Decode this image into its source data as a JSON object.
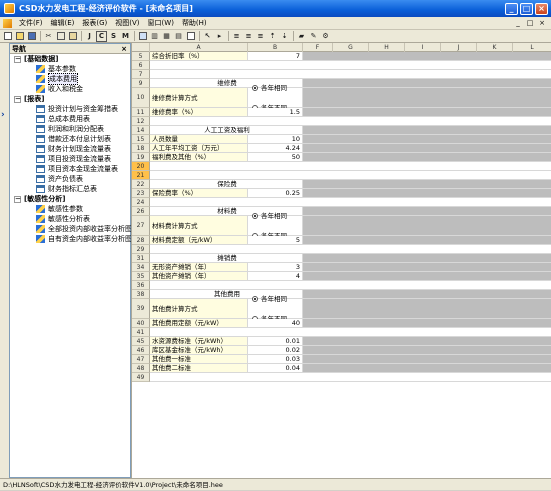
{
  "window": {
    "title": "CSD水力发电工程-经济评价软件 - [未命名项目]",
    "btn_min": "_",
    "btn_max": "□",
    "btn_close": "×"
  },
  "menu": {
    "items": [
      {
        "label": "文件(F)"
      },
      {
        "label": "编辑(E)"
      },
      {
        "label": "报表(G)"
      },
      {
        "label": "视图(V)"
      },
      {
        "label": "窗口(W)"
      },
      {
        "label": "帮助(H)"
      }
    ],
    "mdi": [
      "_",
      "□",
      "×"
    ]
  },
  "toolbar": {
    "letters": [
      "J",
      "C",
      "S",
      "M"
    ]
  },
  "nav": {
    "title": "导航",
    "close": "×",
    "groups": [
      {
        "label": "[基础数据]",
        "toggle": "－",
        "items": [
          "基本参数",
          "成本费用",
          "收入和税金"
        ]
      },
      {
        "label": "[报表]",
        "toggle": "－",
        "items": [
          "投资计划与资金筹措表",
          "总成本费用表",
          "利润和利润分配表",
          "借款还本付息计划表",
          "财务计划现金流量表",
          "项目投资现金流量表",
          "项目资本金现金流量表",
          "资产负债表",
          "财务指标汇总表"
        ]
      },
      {
        "label": "[敏感性分析]",
        "toggle": "－",
        "items": [
          "敏感性参数",
          "敏感性分析表",
          "全部投资内部收益率分析图",
          "自有资金内部收益率分析图"
        ]
      }
    ],
    "selected": "成本费用"
  },
  "sheet": {
    "columns": [
      "A",
      "B",
      "F",
      "G",
      "H",
      "I",
      "J",
      "K",
      "L"
    ],
    "rows": [
      {
        "n": "5",
        "a": "综合折旧率（%）",
        "b": "7"
      },
      {
        "n": "6"
      },
      {
        "n": "7"
      },
      {
        "n": "9",
        "a": "维修费"
      },
      {
        "n": "10",
        "a": "维修费计算方式",
        "radio": [
          "各年相同",
          "各年不同"
        ],
        "checked": 0
      },
      {
        "n": "11",
        "a": "维修费率（%）",
        "b": "1.5"
      },
      {
        "n": "12"
      },
      {
        "n": "14",
        "a": "人工工资及福利"
      },
      {
        "n": "15",
        "a": "人员数量",
        "b": "10"
      },
      {
        "n": "18",
        "a": "人工年平均工资（万元）",
        "b": "4.24"
      },
      {
        "n": "19",
        "a": "福利费及其他（%）",
        "b": "50"
      },
      {
        "n": "20"
      },
      {
        "n": "21"
      },
      {
        "n": "22",
        "a": "保险费"
      },
      {
        "n": "23",
        "a": "保险费率（%）",
        "b": "0.25"
      },
      {
        "n": "24"
      },
      {
        "n": "26",
        "a": "材料费"
      },
      {
        "n": "27",
        "a": "材料费计算方式",
        "radio": [
          "各年相同",
          "各年不同"
        ],
        "checked": 0
      },
      {
        "n": "28",
        "a": "材料费定额（元/kW）",
        "b": "5"
      },
      {
        "n": "29"
      },
      {
        "n": "31",
        "a": "摊销费"
      },
      {
        "n": "34",
        "a": "无形资产摊销（年）",
        "b": "3"
      },
      {
        "n": "35",
        "a": "其他资产摊销（年）",
        "b": "4"
      },
      {
        "n": "36"
      },
      {
        "n": "38",
        "a": "其他费用"
      },
      {
        "n": "39",
        "a": "其他费计算方式",
        "radio": [
          "各年相同",
          "各年不同"
        ],
        "checked": 0
      },
      {
        "n": "40",
        "a": "其他费用定额（元/kW）",
        "b": "40"
      },
      {
        "n": "41"
      },
      {
        "n": "45",
        "a": "水资源费标准（元/kWh）",
        "b": "0.01"
      },
      {
        "n": "46",
        "a": "库区基金标准（元/kWh）",
        "b": "0.02"
      },
      {
        "n": "47",
        "a": "其他费一标准",
        "b": "0.03"
      },
      {
        "n": "48",
        "a": "其他费二标准",
        "b": "0.04"
      },
      {
        "n": "49"
      }
    ]
  },
  "status": {
    "path": "D:\\HLNSoft\\CSD水力发电工程-经济评价软件V1.0\\Project\\未命名项目.hee"
  }
}
